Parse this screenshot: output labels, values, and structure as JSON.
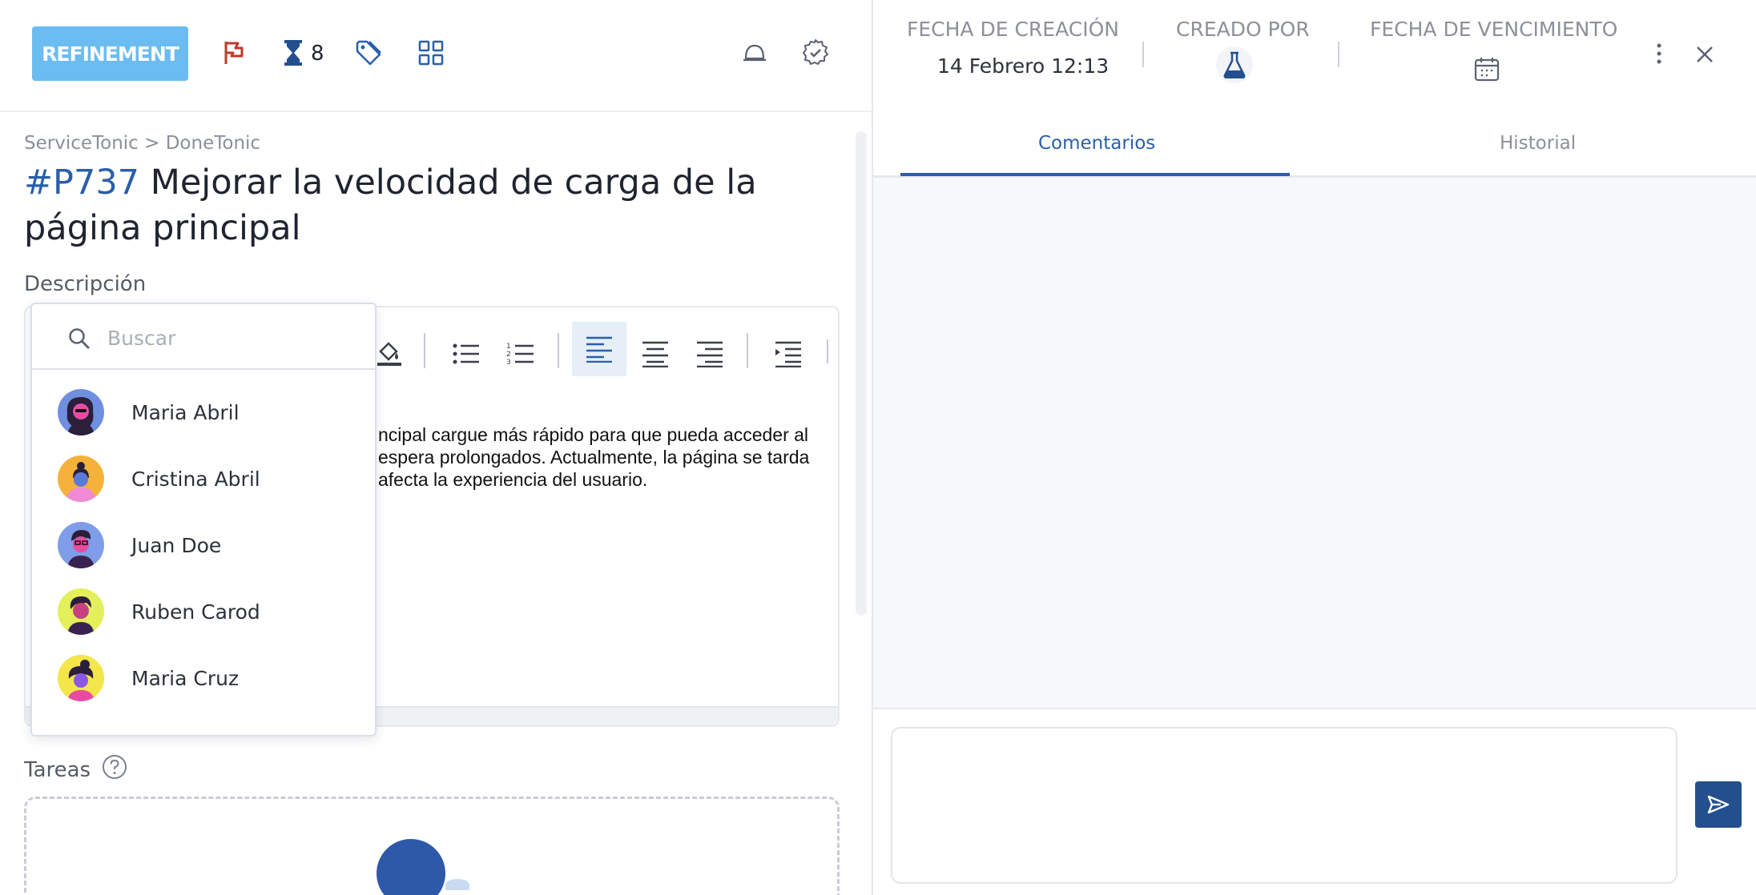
{
  "toolbar": {
    "status_label": "REFINEMENT",
    "estimate_count": "8"
  },
  "task": {
    "breadcrumb": "ServiceTonic > DoneTonic",
    "id": "#P737",
    "title": " Mejorar la velocidad de carga de la página principal",
    "description_label": "Descripción",
    "description_lines": [
      "ncipal cargue más rápido para que pueda acceder al",
      "espera prolongados. Actualmente, la página se tarda",
      "afecta la experiencia del usuario."
    ],
    "tasks_label": "Tareas"
  },
  "user_picker": {
    "search_placeholder": "Buscar",
    "users": [
      {
        "name": "Maria Abril",
        "bg": "#6f8fe0"
      },
      {
        "name": "Cristina Abril",
        "bg": "#f4b23a"
      },
      {
        "name": "Juan Doe",
        "bg": "#7f9de8"
      },
      {
        "name": "Ruben Carod",
        "bg": "#e3f05b"
      },
      {
        "name": "Maria Cruz",
        "bg": "#f2e64a"
      }
    ]
  },
  "meta": {
    "created_label": "FECHA DE CREACIÓN",
    "created_value": "14 Febrero 12:13",
    "creator_label": "CREADO POR",
    "due_label": "FECHA DE VENCIMIENTO"
  },
  "tabs": {
    "comments": "Comentarios",
    "history": "Historial"
  },
  "colors": {
    "accent": "#2a5fa8",
    "status": "#6bbcf0",
    "flag": "#c0392b"
  }
}
